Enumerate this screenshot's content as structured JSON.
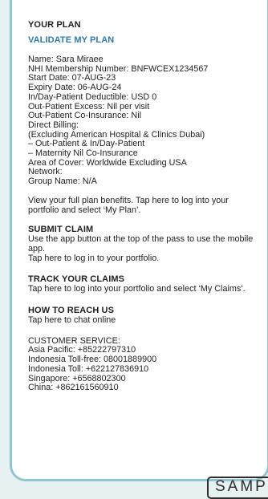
{
  "plan": {
    "heading": "YOUR PLAN",
    "validate_link": "VALIDATE MY PLAN",
    "details": [
      "Name: Sara Miraee",
      "NHI Membership Number: BNFWCEX1234567",
      "Start Date: 07-AUG-23",
      "Expiry Date: 06-AUG-24",
      "In/Day-Patient Deductible: USD 0",
      "Out-Patient Excess: Nil per visit",
      "Out-Patient Co-Insurance: Nil",
      "Direct Billing:",
      "(Excluding American Hospital & Clinics Dubai)",
      "– Out-Patient & In/Day-Patient",
      "– Maternity Nil Co-Insurance",
      "Area of Cover: Worldwide Excluding USA",
      "Network:",
      "Group Name: N/A"
    ],
    "benefits_text": "View your full plan benefits. Tap here to log into your portfolio and select ‘My Plan’."
  },
  "submit_claim": {
    "heading": "SUBMIT CLAIM",
    "text1": "Use the app button at the top of the pass to use the mobile app.",
    "text2": "Tap here to log in to your portfolio."
  },
  "track_claims": {
    "heading": "TRACK YOUR CLAIMS",
    "text": "Tap here to log into your portfolio and select ‘My Claims’."
  },
  "reach_us": {
    "heading": "HOW TO REACH US",
    "chat_text": "Tap here to chat online",
    "customer_service_label": "CUSTOMER SERVICE:",
    "phones": [
      "Asia Pacific: +85222797310",
      "Indonesia Toll-free: 08001889900",
      "Indonesia Toll: +622127836910",
      "Singapore: +6568802300",
      "China: +862161560910"
    ]
  },
  "watermark": "SAMP",
  "colors": {
    "accent": "#2b7bb0",
    "card_border": "#8fc6cf",
    "background": "#e6f1f2"
  }
}
